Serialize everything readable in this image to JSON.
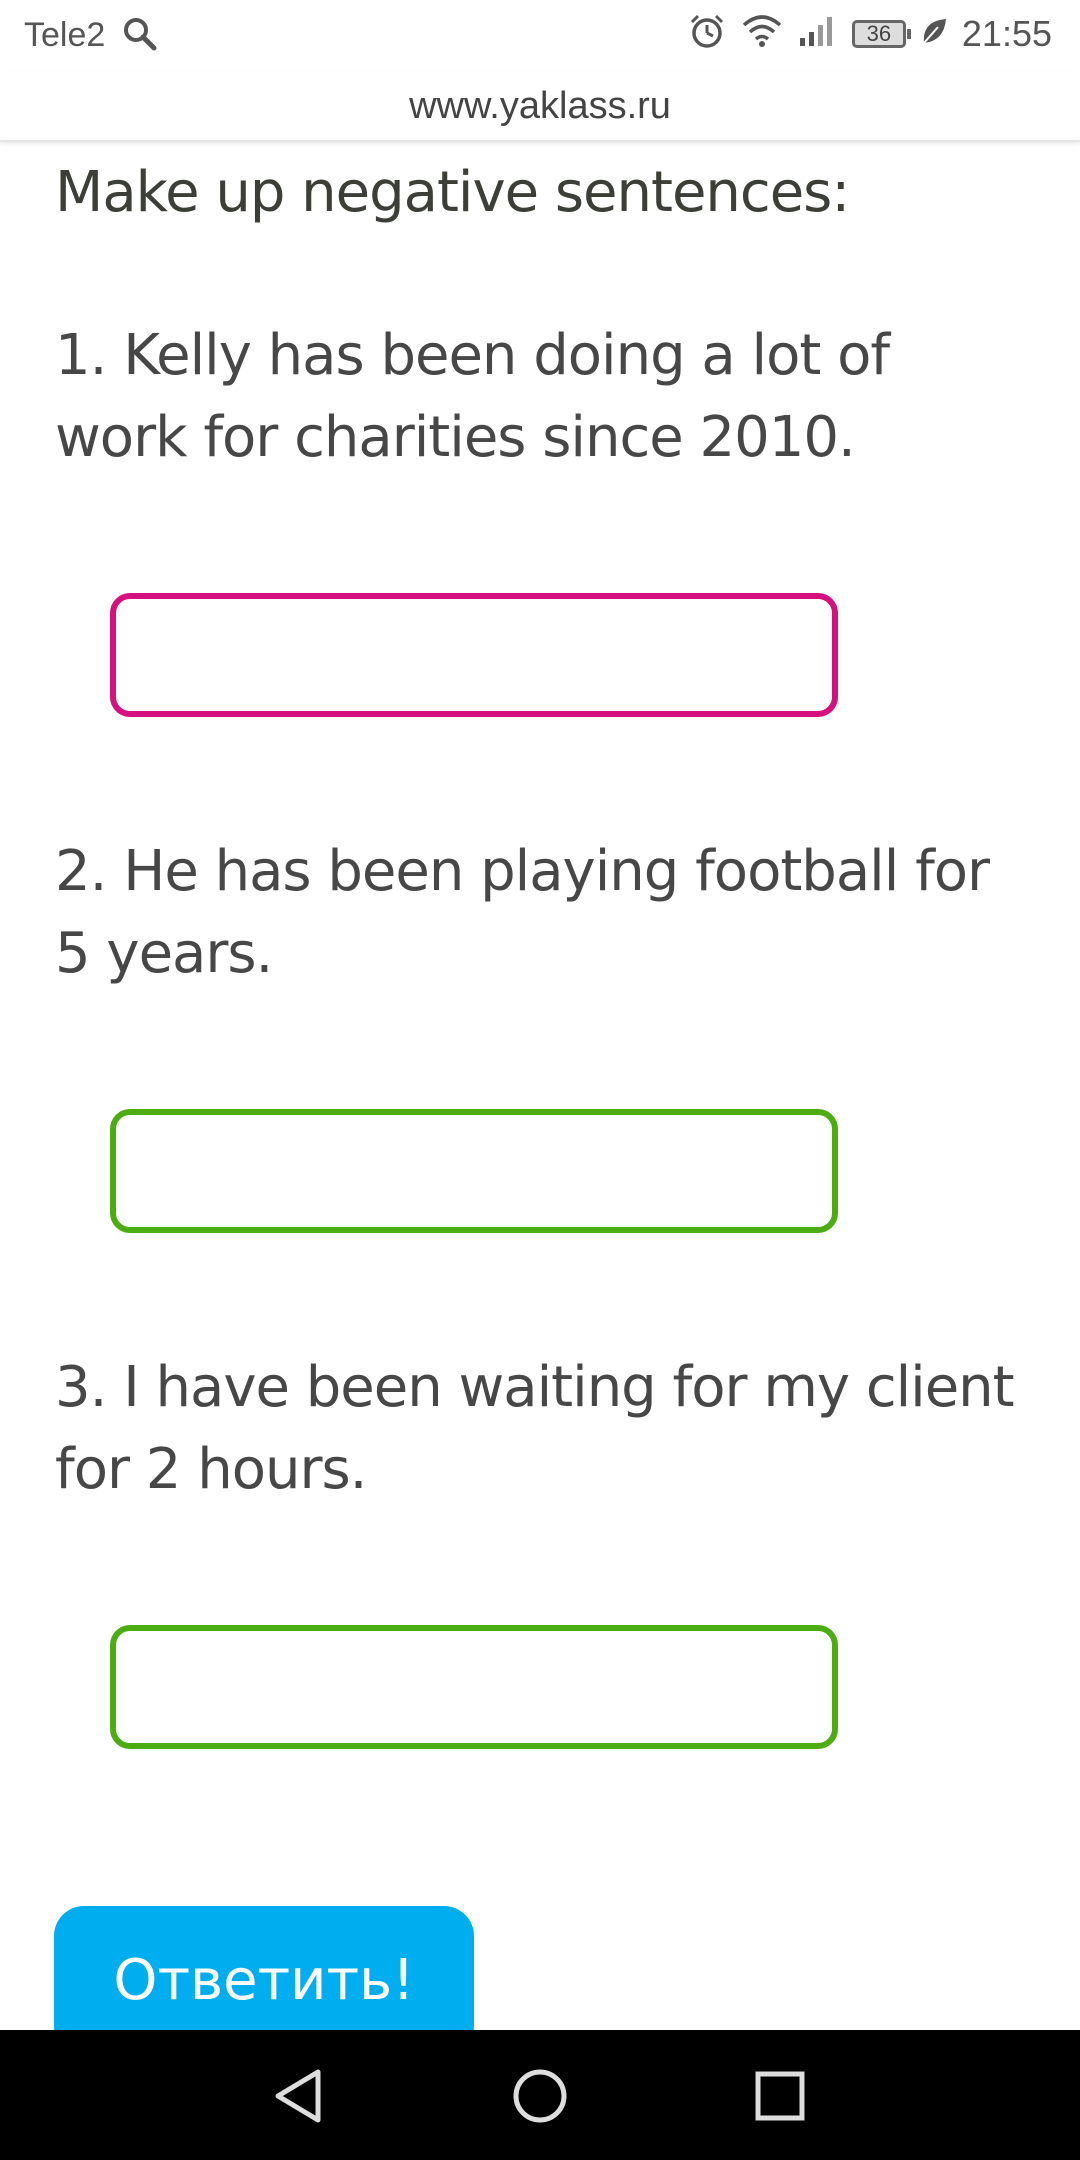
{
  "status_bar": {
    "carrier": "Tele2",
    "battery_level": "36",
    "time": "21:55"
  },
  "browser": {
    "url": "www.yaklass.ru"
  },
  "exercise": {
    "heading": "Make up negative sentences:",
    "questions": [
      {
        "text": "1. Kelly has been doing a lot of work for charities since 2010.",
        "answer": "",
        "state": "invalid",
        "border_color": "#d4117e"
      },
      {
        "text": "2. He has been playing football for 5 years.",
        "answer": "",
        "state": "valid",
        "border_color": "#4cad12"
      },
      {
        "text": "3. I have been waiting for my client for 2 hours.",
        "answer": "",
        "state": "valid",
        "border_color": "#4cad12"
      }
    ],
    "submit_label": "Ответить!"
  },
  "colors": {
    "accent": "#00aeef",
    "nav_bar": "#000000"
  },
  "icons": {
    "status": [
      "search-icon",
      "alarm-icon",
      "wifi-icon",
      "signal-icon",
      "battery-icon",
      "leaf-icon"
    ],
    "nav": [
      "back-icon",
      "home-icon",
      "recents-icon"
    ]
  }
}
